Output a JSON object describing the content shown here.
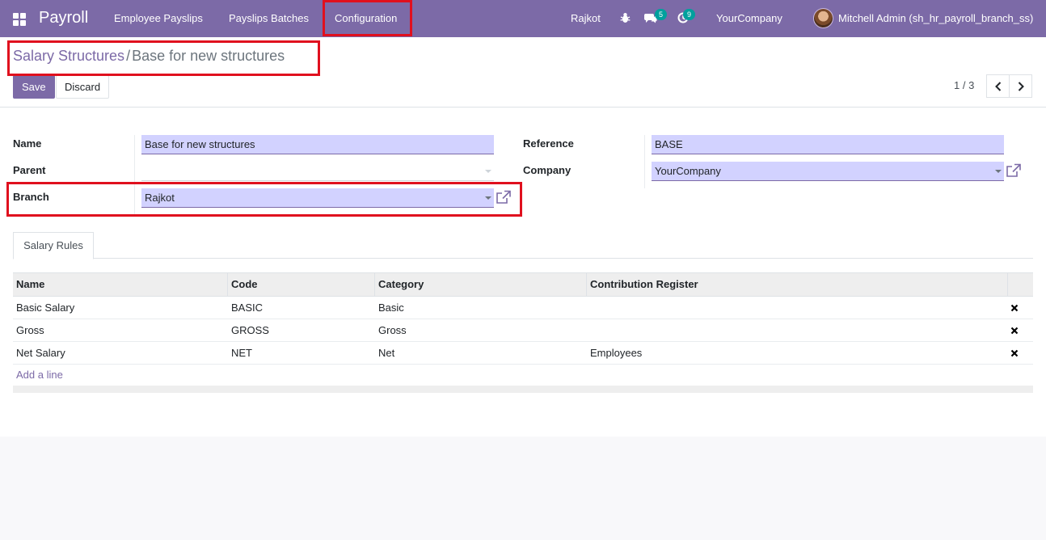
{
  "navbar": {
    "app_name": "Payroll",
    "menu": [
      "Employee Payslips",
      "Payslips Batches",
      "Configuration"
    ],
    "branch": "Rajkot",
    "messages_count": "5",
    "activities_count": "9",
    "company": "YourCompany",
    "user": "Mitchell Admin (sh_hr_payroll_branch_ss)",
    "accent_color": "#7c6aa7"
  },
  "breadcrumb": {
    "parent": "Salary Structures",
    "separator": "/",
    "current": "Base for new structures"
  },
  "actions": {
    "save": "Save",
    "discard": "Discard"
  },
  "pager": {
    "value": "1 / 3"
  },
  "form": {
    "name_label": "Name",
    "name_value": "Base for new structures",
    "parent_label": "Parent",
    "parent_value": "",
    "branch_label": "Branch",
    "branch_value": "Rajkot",
    "reference_label": "Reference",
    "reference_value": "BASE",
    "company_label": "Company",
    "company_value": "YourCompany"
  },
  "tabs": [
    "Salary Rules"
  ],
  "rules_table": {
    "columns": [
      "Name",
      "Code",
      "Category",
      "Contribution Register"
    ],
    "rows": [
      {
        "name": "Basic Salary",
        "code": "BASIC",
        "category": "Basic",
        "register": ""
      },
      {
        "name": "Gross",
        "code": "GROSS",
        "category": "Gross",
        "register": ""
      },
      {
        "name": "Net Salary",
        "code": "NET",
        "category": "Net",
        "register": "Employees"
      }
    ],
    "add_line": "Add a line"
  },
  "highlight_color": "#e0101e"
}
